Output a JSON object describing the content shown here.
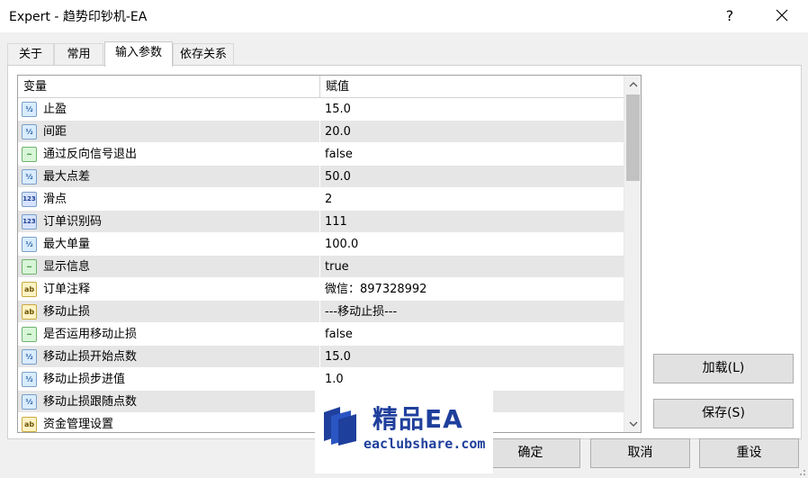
{
  "window": {
    "title": "Expert - 趋势印钞机-EA",
    "help_label": "?",
    "close_label": "✕"
  },
  "tabs": [
    {
      "label": "关于"
    },
    {
      "label": "常用"
    },
    {
      "label": "输入参数"
    },
    {
      "label": "依存关系"
    }
  ],
  "grid": {
    "headers": {
      "variable": "变量",
      "value": "赋值"
    },
    "rows": [
      {
        "icon": "double-type-icon",
        "name": "止盈",
        "value": "15.0"
      },
      {
        "icon": "double-type-icon",
        "name": "间距",
        "value": "20.0"
      },
      {
        "icon": "bool-type-icon",
        "name": "通过反向信号退出",
        "value": "false"
      },
      {
        "icon": "double-type-icon",
        "name": "最大点差",
        "value": "50.0"
      },
      {
        "icon": "int-type-icon",
        "name": "滑点",
        "value": "2"
      },
      {
        "icon": "int-type-icon",
        "name": "订单识别码",
        "value": "111"
      },
      {
        "icon": "double-type-icon",
        "name": "最大单量",
        "value": "100.0"
      },
      {
        "icon": "bool-type-icon",
        "name": "显示信息",
        "value": "true"
      },
      {
        "icon": "string-type-icon",
        "name": "订单注释",
        "value": "微信：897328992"
      },
      {
        "icon": "string-type-icon",
        "name": "移动止损",
        "value": "---移动止损---"
      },
      {
        "icon": "bool-type-icon",
        "name": "是否运用移动止损",
        "value": "false"
      },
      {
        "icon": "double-type-icon",
        "name": "移动止损开始点数",
        "value": "15.0"
      },
      {
        "icon": "double-type-icon",
        "name": "移动止损步进值",
        "value": "1.0"
      },
      {
        "icon": "double-type-icon",
        "name": "移动止损跟随点数",
        "value": ""
      },
      {
        "icon": "string-type-icon",
        "name": "资金管理设置",
        "value": ""
      }
    ]
  },
  "buttons": {
    "load": "加载(L)",
    "save": "保存(S)",
    "ok": "确定",
    "cancel": "取消",
    "reset": "重设"
  },
  "watermark": {
    "title": "精品EA",
    "url": "eaclubshare.com"
  }
}
